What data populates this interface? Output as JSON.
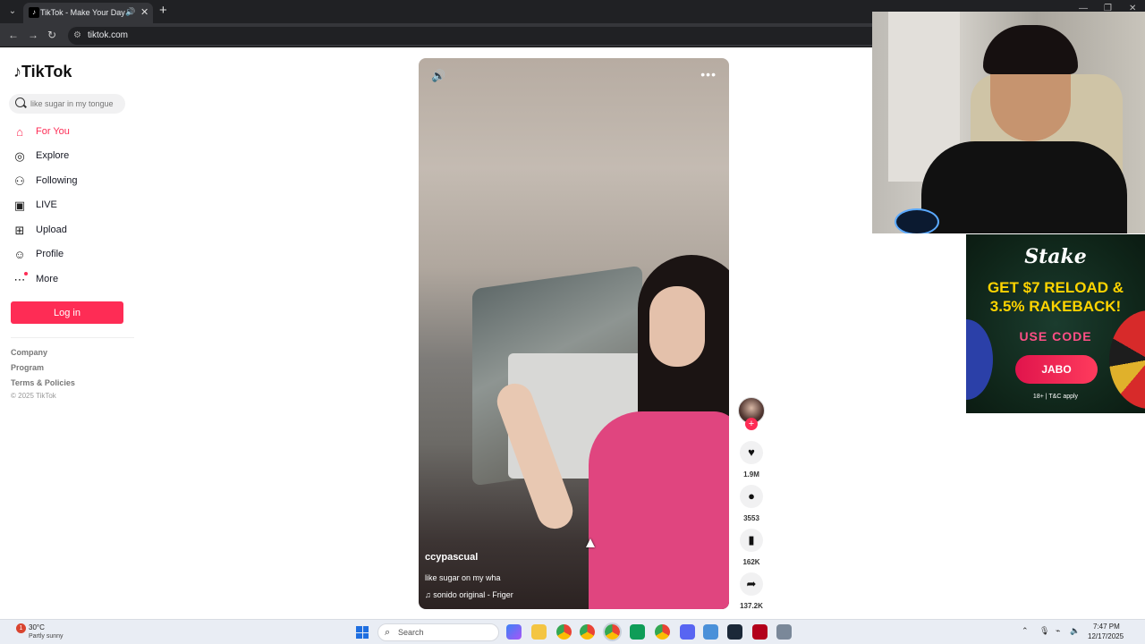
{
  "browser": {
    "tab_title": "TikTok - Make Your Day",
    "url": "tiktok.com",
    "new_tab_label": "+",
    "tab_close_label": "✕"
  },
  "sidebar": {
    "logo": "TikTok",
    "search_placeholder": "like sugar in my tongue",
    "items": [
      {
        "label": "For You",
        "icon": "home-icon",
        "active": true
      },
      {
        "label": "Explore",
        "icon": "compass-icon",
        "active": false
      },
      {
        "label": "Following",
        "icon": "following-icon",
        "active": false
      },
      {
        "label": "LIVE",
        "icon": "live-icon",
        "active": false
      },
      {
        "label": "Upload",
        "icon": "upload-icon",
        "active": false
      },
      {
        "label": "Profile",
        "icon": "profile-icon",
        "active": false
      },
      {
        "label": "More",
        "icon": "more-icon",
        "active": false
      }
    ],
    "login_label": "Log in",
    "footer": {
      "company": "Company",
      "program": "Program",
      "terms": "Terms & Policies",
      "copyright": "© 2025 TikTok"
    }
  },
  "video": {
    "author": "ccypascual",
    "caption": "like sugar on my wha",
    "music": "sonido original - Friger",
    "likes": "1.9M",
    "comments": "3553",
    "saves": "162K",
    "shares": "137.2K"
  },
  "ad": {
    "brand": "Stake",
    "headline_line1": "GET $7 RELOAD &",
    "headline_line2": "3.5% RAKEBACK!",
    "use_code": "USE CODE",
    "code": "JABO",
    "terms": "18+ | T&C apply"
  },
  "taskbar": {
    "weather_temp": "30°C",
    "weather_desc": "Partly sunny",
    "weather_badge": "1",
    "search_label": "Search",
    "time": "7:47 PM",
    "date": "12/17/2025"
  },
  "colors": {
    "tiktok_accent": "#fe2c55",
    "ad_yellow": "#ffd400",
    "ad_pink": "#ff4f86"
  }
}
